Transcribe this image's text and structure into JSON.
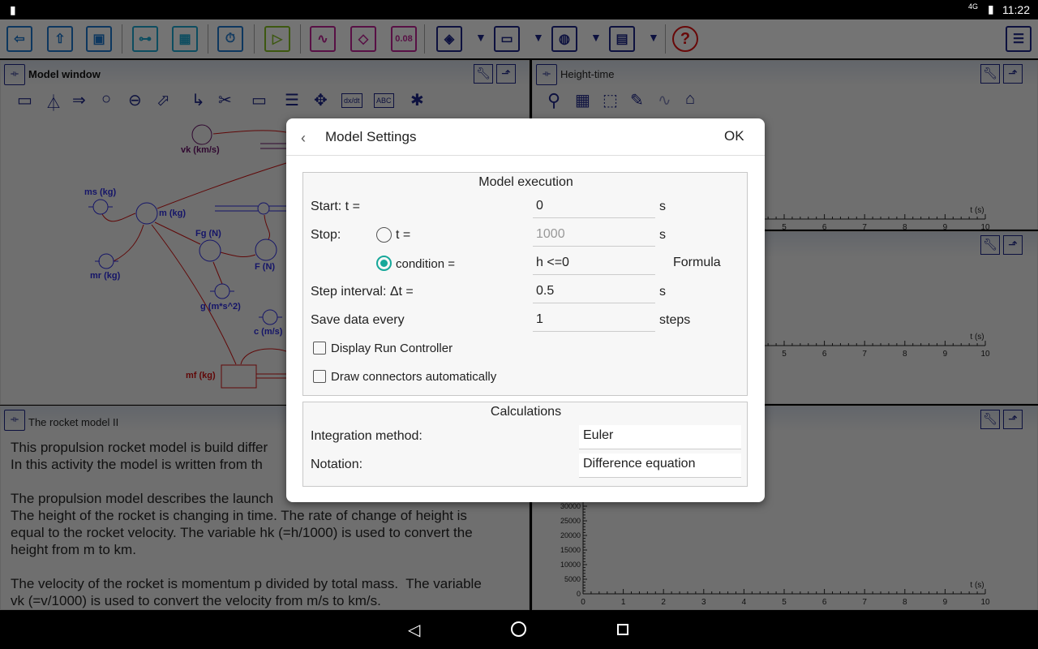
{
  "status": {
    "network": "4G",
    "time": "11:22"
  },
  "toolbar": {
    "items": [
      {
        "name": "exit-icon",
        "glyph": "⇦",
        "color": "#1a6fbf"
      },
      {
        "name": "open-icon",
        "glyph": "⇧",
        "color": "#1a6fbf"
      },
      {
        "name": "save-icon",
        "glyph": "▣",
        "color": "#1a6fbf"
      },
      {
        "name": "model-icon",
        "glyph": "⊶",
        "color": "#1a9bc0"
      },
      {
        "name": "table-icon",
        "glyph": "▦",
        "color": "#1a9bc0"
      },
      {
        "name": "stopwatch-icon",
        "glyph": "⏱",
        "color": "#1a6fbf"
      },
      {
        "name": "play-icon",
        "glyph": "▷",
        "color": "#7ab020"
      },
      {
        "name": "graph-icon",
        "glyph": "∿",
        "color": "#b0208a"
      },
      {
        "name": "meter-icon",
        "glyph": "◇",
        "color": "#b0208a"
      },
      {
        "name": "value-display-icon",
        "glyph": "0.08",
        "color": "#b0208a"
      },
      {
        "name": "eraser-icon",
        "glyph": "◈",
        "color": "#1a237e"
      },
      {
        "name": "image-icon",
        "glyph": "▭",
        "color": "#1a237e"
      },
      {
        "name": "web-icon",
        "glyph": "◍",
        "color": "#1a237e"
      },
      {
        "name": "documents-icon",
        "glyph": "▤",
        "color": "#1a237e"
      },
      {
        "name": "help-icon",
        "glyph": "?",
        "color": "#d01010"
      },
      {
        "name": "notes-icon",
        "glyph": "☰",
        "color": "#1a237e"
      }
    ]
  },
  "model_window": {
    "title": "Model window",
    "tools": [
      "▭",
      "⏃",
      "⇒",
      "○",
      "⊖",
      "⬀",
      "↳",
      "✂",
      "▭",
      "☰",
      "✥",
      "dx/dt",
      "ABC",
      "✱"
    ],
    "nodes": {
      "vk": "vk (km/s)",
      "ms": "ms (kg)",
      "m": "m (kg)",
      "mr": "mr (kg)",
      "fg": "Fg (N)",
      "f": "F (N)",
      "g": "g (m*s^2)",
      "c": "c (m/s)",
      "mf": "mf (kg)"
    }
  },
  "height_panel": {
    "title": "Height-time"
  },
  "text_panel": {
    "title": "The rocket model II",
    "text": "This propulsion rocket model is build differ\nIn this activity the model is written from th\n\nThe propulsion model describes the launch\nThe height of the rocket is changing in time. The rate of change of height is\nequal to the rocket velocity. The variable hk (=h/1000) is used to convert the\nheight from m to km.\n\nThe velocity of the rocket is momentum p divided by total mass.  The variable\nvk (=v/1000) is used to convert the velocity from m/s to km/s."
  },
  "charts": {
    "xlabel": "t (s)",
    "xticks": [
      0,
      1,
      2,
      3,
      4,
      5,
      6,
      7,
      8,
      9,
      10
    ],
    "yticks": [
      0,
      5000,
      10000,
      15000,
      20000,
      25000,
      30000
    ]
  },
  "dialog": {
    "title": "Model Settings",
    "ok": "OK",
    "exec": {
      "title": "Model execution",
      "start_label": "Start:  t =",
      "start": "0",
      "unit_s": "s",
      "stop_label": "Stop:",
      "stop_t_label": "t =",
      "stop_t": "1000",
      "cond_label": "condition =",
      "cond": "h <=0",
      "formula": "Formula",
      "step_label": "Step interval:  Δt =",
      "step": "0.5",
      "save_label": "Save data every",
      "save": "1",
      "steps": "steps",
      "run_ctrl": "Display Run Controller",
      "connectors": "Draw connectors automatically"
    },
    "calc": {
      "title": "Calculations",
      "method_label": "Integration method:",
      "method": "Euler",
      "notation_label": "Notation:",
      "notation": "Difference equation"
    }
  },
  "colors": {
    "accent": "#17a89a"
  }
}
